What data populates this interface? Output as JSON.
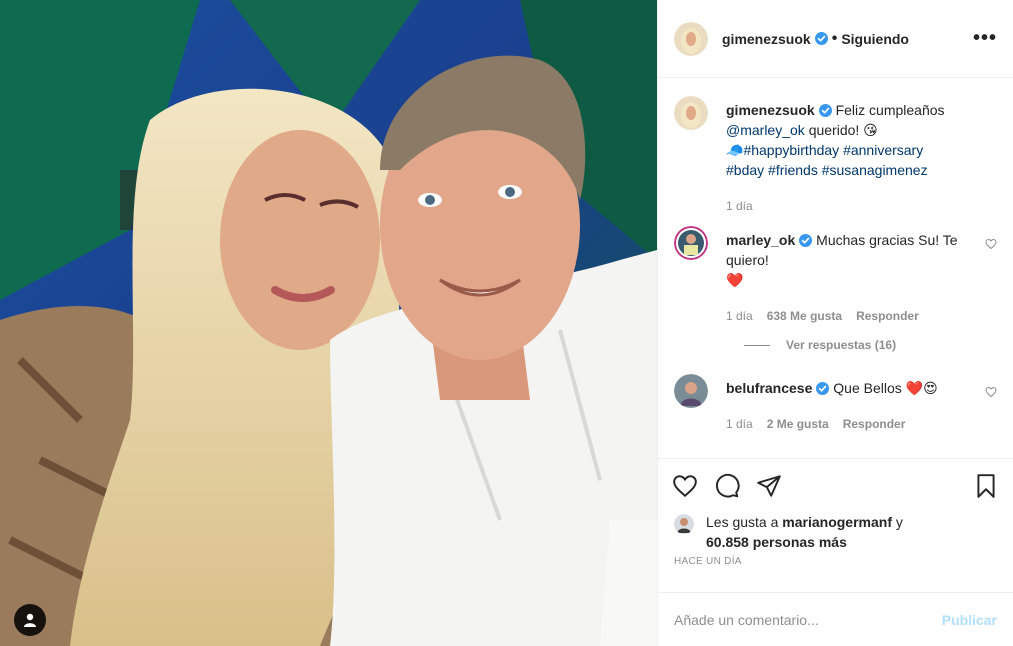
{
  "post": {
    "username": "gimenezsuok",
    "follow_status": "Siguiendo",
    "separator": "•",
    "more_label": "•••"
  },
  "caption": {
    "username": "gimenezsuok",
    "text_1": "Feliz cumpleaños",
    "mention": "@marley_ok",
    "text_2": "querido! 😘",
    "emoji_cap": "🧢",
    "hashtags_1": "#happybirthday #anniversary",
    "hashtags_2": "#bday #friends #susanagimenez",
    "time": "1 día"
  },
  "comments": [
    {
      "username": "marley_ok",
      "text": "Muchas gracias Su! Te quiero!",
      "emoji": "❤️",
      "time": "1 día",
      "likes": "638 Me gusta",
      "reply": "Responder"
    },
    {
      "username": "belufrancese",
      "text": "Que Bellos ❤️😍",
      "time": "1 día",
      "likes": "2 Me gusta",
      "reply": "Responder"
    }
  ],
  "view_replies": "Ver respuestas (16)",
  "likes_line": {
    "prefix": "Les gusta a",
    "user": "marianogermanf",
    "suffix": "y",
    "count": "60.858 personas más"
  },
  "posted_time": "HACE UN DÍA",
  "comment_box": {
    "placeholder": "Añade un comentario...",
    "post_label": "Publicar"
  },
  "colors": {
    "verified": "#3897f0",
    "link": "#00376b",
    "muted": "#8e8e8e",
    "publish_disabled": "#b2dffc"
  },
  "icons": [
    "heart-icon",
    "comment-icon",
    "share-icon",
    "bookmark-icon",
    "more-icon",
    "user-tag-icon",
    "verified-icon"
  ]
}
